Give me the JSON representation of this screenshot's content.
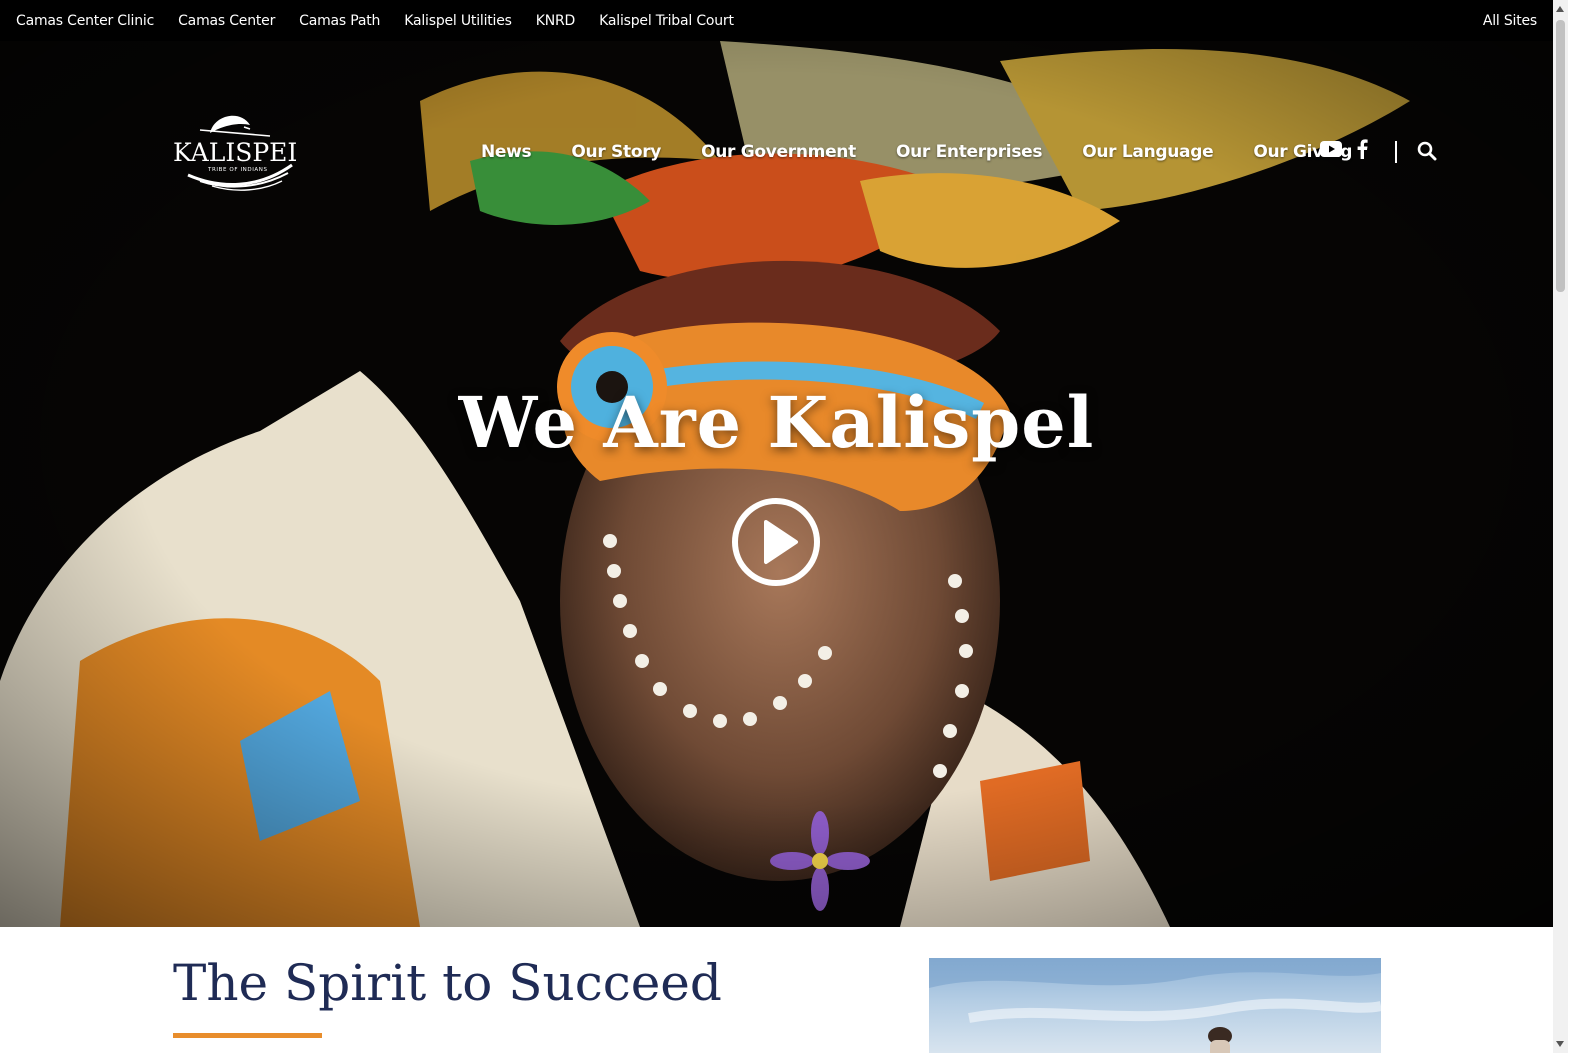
{
  "topbar": {
    "links": [
      "Camas Center Clinic",
      "Camas Center",
      "Camas Path",
      "Kalispel Utilities",
      "KNRD",
      "Kalispel Tribal Court"
    ],
    "all_sites": "All Sites"
  },
  "header": {
    "logo_name": "KALISPEL",
    "logo_sub": "TRIBE OF INDIANS",
    "nav": [
      "News",
      "Our Story",
      "Our Government",
      "Our Enterprises",
      "Our Language",
      "Our Giving"
    ],
    "social_icons": [
      "youtube-icon",
      "facebook-icon"
    ],
    "search_icon": "search-icon"
  },
  "hero": {
    "title": "We Are Kalispel",
    "play_icon": "play-icon"
  },
  "intro": {
    "title": "The Spirit to Succeed"
  },
  "colors": {
    "navy": "#1f2b55",
    "accent_orange": "#e88d2c",
    "topbar_bg": "#000000"
  }
}
